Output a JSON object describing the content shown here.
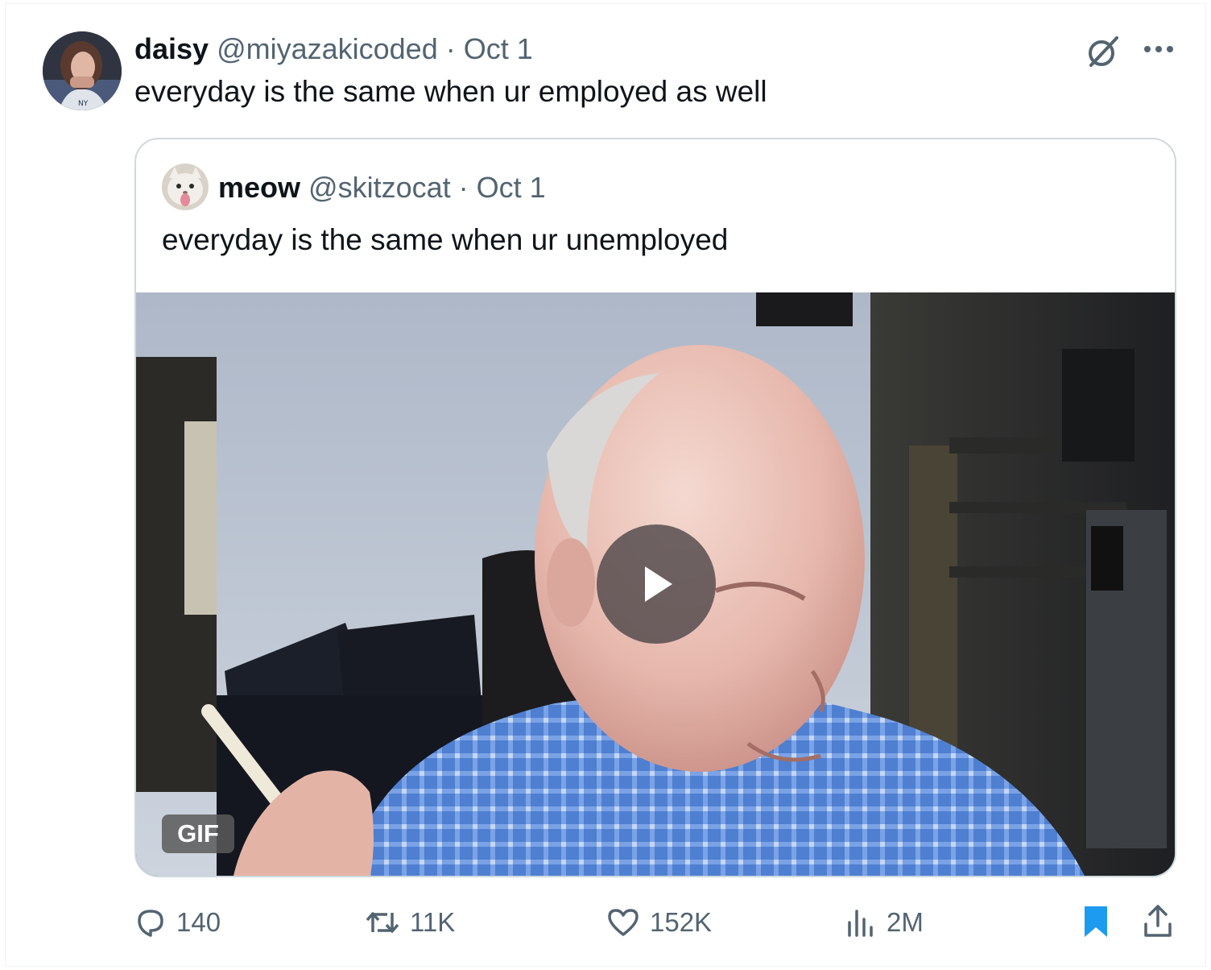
{
  "tweet": {
    "author": {
      "name": "daisy",
      "handle": "@miyazakicoded",
      "separator": "·",
      "date": "Oct 1",
      "avatar": "profile-photo"
    },
    "text": "everyday is the same when ur employed as well",
    "icons": {
      "grok": "grok-icon",
      "more": "more-icon"
    }
  },
  "quote": {
    "author": {
      "name": "meow",
      "handle": "@skitzocat",
      "separator": "·",
      "date": "Oct 1",
      "avatar": "cat-photo"
    },
    "text": "everyday is the same when ur unemployed",
    "media": {
      "type": "gif",
      "badge": "GIF",
      "play_icon": "play-icon"
    }
  },
  "actions": {
    "replies": "140",
    "retweets": "11K",
    "likes": "152K",
    "views": "2M",
    "bookmark_active": true,
    "accent_color": "#1d9bf0"
  }
}
